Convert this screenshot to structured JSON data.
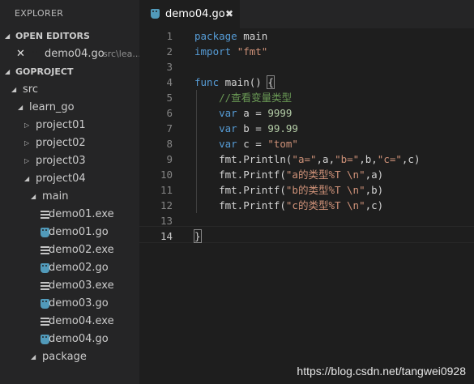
{
  "sidebar": {
    "title": "EXPLORER",
    "open_editors": {
      "header": "OPEN EDITORS",
      "item": {
        "name": "demo04.go",
        "path": "src\\lea..."
      }
    },
    "project": {
      "header": "GOPROJECT",
      "tree": [
        {
          "label": "src",
          "icon": "folder",
          "expanded": true
        },
        {
          "label": "learn_go",
          "icon": "folder",
          "expanded": true
        },
        {
          "label": "project01",
          "icon": "folder",
          "expanded": false
        },
        {
          "label": "project02",
          "icon": "folder",
          "expanded": false
        },
        {
          "label": "project03",
          "icon": "folder",
          "expanded": false
        },
        {
          "label": "project04",
          "icon": "folder",
          "expanded": true
        },
        {
          "label": "main",
          "icon": "folder",
          "expanded": true
        },
        {
          "label": "demo01.exe",
          "icon": "exe-file-icon"
        },
        {
          "label": "demo01.go",
          "icon": "go-file-icon"
        },
        {
          "label": "demo02.exe",
          "icon": "exe-file-icon"
        },
        {
          "label": "demo02.go",
          "icon": "go-file-icon"
        },
        {
          "label": "demo03.exe",
          "icon": "exe-file-icon"
        },
        {
          "label": "demo03.go",
          "icon": "go-file-icon"
        },
        {
          "label": "demo04.exe",
          "icon": "exe-file-icon"
        },
        {
          "label": "demo04.go",
          "icon": "go-file-icon"
        },
        {
          "label": "package",
          "icon": "folder",
          "expanded": true
        }
      ]
    }
  },
  "tab": {
    "label": "demo04.go",
    "close": "✖"
  },
  "editor": {
    "current_line": 14,
    "lines": [
      {
        "n": "1",
        "t": [
          [
            "kw",
            "package"
          ],
          [
            "p",
            " main"
          ]
        ]
      },
      {
        "n": "2",
        "t": [
          [
            "kw",
            "import"
          ],
          [
            "p",
            " "
          ],
          [
            "str",
            "\"fmt\""
          ]
        ]
      },
      {
        "n": "3",
        "t": []
      },
      {
        "n": "4",
        "t": [
          [
            "kw",
            "func"
          ],
          [
            "p",
            " main() "
          ],
          [
            "brace",
            "{"
          ]
        ]
      },
      {
        "n": "5",
        "t": [
          [
            "p",
            "    "
          ],
          [
            "cmt",
            "//查看变量类型"
          ]
        ]
      },
      {
        "n": "6",
        "t": [
          [
            "p",
            "    "
          ],
          [
            "kw",
            "var"
          ],
          [
            "p",
            " a = "
          ],
          [
            "num",
            "9999"
          ]
        ]
      },
      {
        "n": "7",
        "t": [
          [
            "p",
            "    "
          ],
          [
            "kw",
            "var"
          ],
          [
            "p",
            " b = "
          ],
          [
            "num",
            "99.99"
          ]
        ]
      },
      {
        "n": "8",
        "t": [
          [
            "p",
            "    "
          ],
          [
            "kw",
            "var"
          ],
          [
            "p",
            " c = "
          ],
          [
            "str",
            "\"tom\""
          ]
        ]
      },
      {
        "n": "9",
        "t": [
          [
            "p",
            "    fmt.Println("
          ],
          [
            "str",
            "\"a=\""
          ],
          [
            "p",
            ",a,"
          ],
          [
            "str",
            "\"b=\""
          ],
          [
            "p",
            ",b,"
          ],
          [
            "str",
            "\"c=\""
          ],
          [
            "p",
            ",c)"
          ]
        ]
      },
      {
        "n": "10",
        "t": [
          [
            "p",
            "    fmt.Printf("
          ],
          [
            "str",
            "\"a的类型%T \\n\""
          ],
          [
            "p",
            ",a)"
          ]
        ]
      },
      {
        "n": "11",
        "t": [
          [
            "p",
            "    fmt.Printf("
          ],
          [
            "str",
            "\"b的类型%T \\n\""
          ],
          [
            "p",
            ",b)"
          ]
        ]
      },
      {
        "n": "12",
        "t": [
          [
            "p",
            "    fmt.Printf("
          ],
          [
            "str",
            "\"c的类型%T \\n\""
          ],
          [
            "p",
            ",c)"
          ]
        ]
      },
      {
        "n": "13",
        "t": []
      },
      {
        "n": "14",
        "t": [
          [
            "brace",
            "}"
          ]
        ]
      }
    ]
  },
  "watermark": "https://blog.csdn.net/tangwei0928",
  "colors": {
    "keyword": "#569cd6",
    "string": "#ce9178",
    "number": "#b5cea8",
    "comment": "#6a9955",
    "go_icon": "#519aba"
  }
}
